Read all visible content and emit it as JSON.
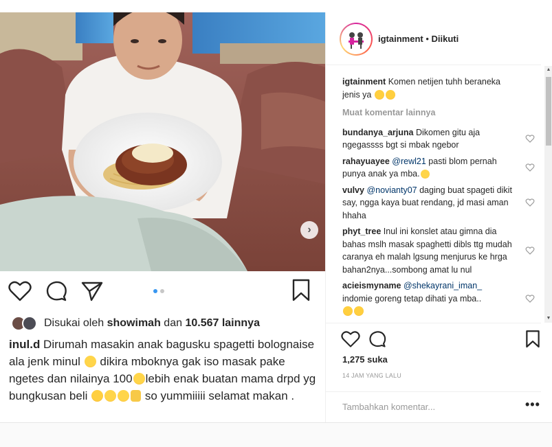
{
  "post": {
    "next_label": "›",
    "carousel_dots": 2,
    "carousel_active": 0
  },
  "left": {
    "liked_prefix": "Disukai oleh",
    "liked_user": "showimah",
    "liked_and": "dan",
    "liked_count": "10.567 lainnya",
    "caption_user": "inul.d",
    "caption_parts": [
      " Dirumah masakin anak bagusku spagetti bolognaise ala jenk minul ",
      " dikira mboknya gak iso masak pake ngetes dan nilainya 100",
      "lebih enak buatan mama drpd yg bungkusan beli ",
      "so yummiiiii selamat makan ."
    ]
  },
  "header": {
    "username": "igtainment",
    "separator": " • ",
    "follow_status": "Diikuti"
  },
  "comments": {
    "owner": {
      "user": "igtainment",
      "text": "Komen netijen tuhh beraneka jenis ya"
    },
    "load_more": "Muat komentar lainnya",
    "items": [
      {
        "user": "bundanya_arjuna",
        "text": "Dikomen gitu aja ngegassss bgt si mbak ngebor"
      },
      {
        "user": "rahayuayee",
        "mention": "@rewl21",
        "text": "pasti blom pernah punya anak ya mba."
      },
      {
        "user": "vulvy",
        "mention": "@novianty07",
        "text": "daging buat spageti dikit say, ngga kaya buat rendang, jd masi aman hhaha"
      },
      {
        "user": "phyt_tree",
        "text": "Inul ini konslet atau gimna dia bahas mslh masak spaghetti dibls ttg mudah caranya eh malah lgsung menjurus ke hrga bahan2nya...sombong amat lu nul"
      },
      {
        "user": "acieismyname",
        "mention": "@shekayrani_iman_",
        "text": "indomie goreng tetap dihati ya mba.."
      }
    ]
  },
  "right": {
    "likes": "1,275 suka",
    "timestamp": "14 JAM YANG LALU",
    "add_comment_placeholder": "Tambahkan komentar...",
    "more": "•••"
  },
  "colors": {
    "accent": "#3897f0",
    "mention": "#003569",
    "muted": "#999999"
  }
}
